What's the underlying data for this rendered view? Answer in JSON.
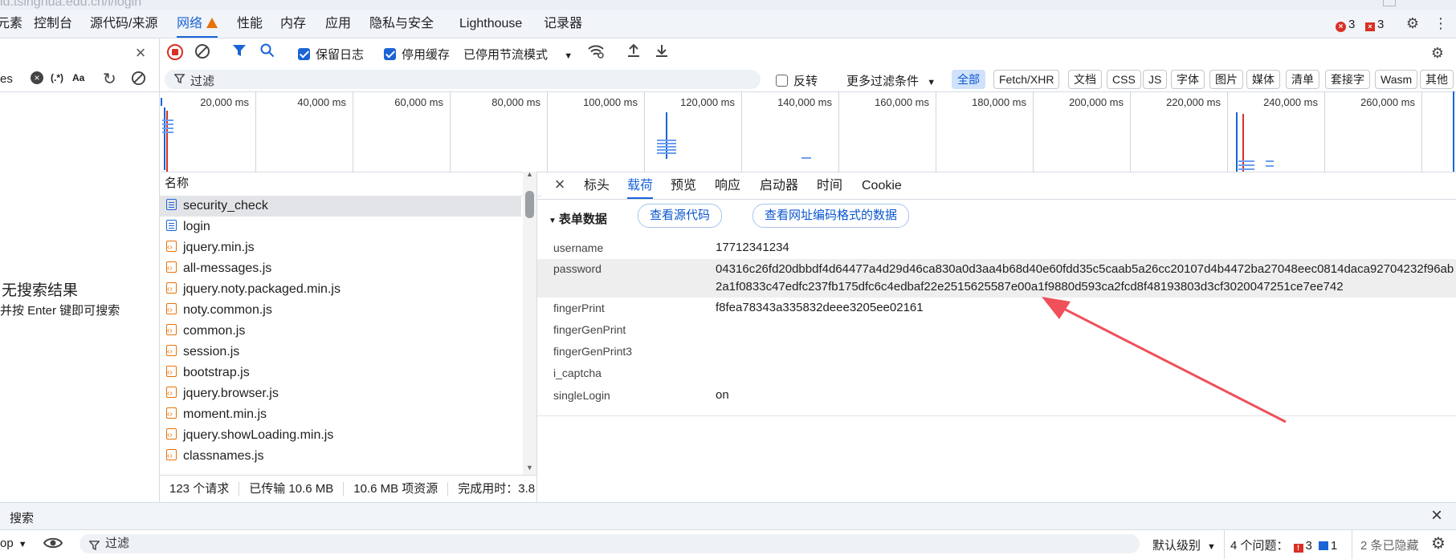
{
  "url": "id.tsinghua.edu.cn/i/login",
  "main_tabs": [
    {
      "label": "元素"
    },
    {
      "label": "控制台"
    },
    {
      "label": "源代码/来源"
    },
    {
      "label": "网络"
    },
    {
      "label": "性能"
    },
    {
      "label": "内存"
    },
    {
      "label": "应用"
    },
    {
      "label": "隐私与安全"
    },
    {
      "label": "Lighthouse"
    },
    {
      "label": "记录器"
    }
  ],
  "issues": {
    "errors": "3",
    "warnings": "3"
  },
  "toolbar": {
    "preserve_log": "保留日志",
    "disable_cache": "停用缓存",
    "throttle": "已停用节流模式"
  },
  "left": {
    "search_prefix": "es",
    "regex": "(.*)",
    "case": "Aa",
    "no_results": "无搜索结果",
    "hint": "并按 Enter 键即可搜索"
  },
  "filter": {
    "placeholder": "过滤",
    "invert": "反转",
    "more": "更多过滤条件",
    "types": [
      "全部",
      "Fetch/XHR",
      "文档",
      "CSS",
      "JS",
      "字体",
      "图片",
      "媒体",
      "清单",
      "套接字",
      "Wasm",
      "其他"
    ]
  },
  "timeline_ticks": [
    "20,000 ms",
    "40,000 ms",
    "60,000 ms",
    "80,000 ms",
    "100,000 ms",
    "120,000 ms",
    "140,000 ms",
    "160,000 ms",
    "180,000 ms",
    "200,000 ms",
    "220,000 ms",
    "240,000 ms",
    "260,000 ms"
  ],
  "list": {
    "header": "名称",
    "rows": [
      {
        "name": "security_check",
        "type": "doc"
      },
      {
        "name": "login",
        "type": "doc"
      },
      {
        "name": "jquery.min.js",
        "type": "js"
      },
      {
        "name": "all-messages.js",
        "type": "js"
      },
      {
        "name": "jquery.noty.packaged.min.js",
        "type": "js"
      },
      {
        "name": "noty.common.js",
        "type": "js"
      },
      {
        "name": "common.js",
        "type": "js"
      },
      {
        "name": "session.js",
        "type": "js"
      },
      {
        "name": "bootstrap.js",
        "type": "js"
      },
      {
        "name": "jquery.browser.js",
        "type": "js"
      },
      {
        "name": "moment.min.js",
        "type": "js"
      },
      {
        "name": "jquery.showLoading.min.js",
        "type": "js"
      },
      {
        "name": "classnames.js",
        "type": "js"
      }
    ],
    "status": {
      "requests": "123 个请求",
      "transferred": "已传输 10.6 MB",
      "resources": "10.6 MB 项资源",
      "finish": "完成用时：3.8"
    }
  },
  "detail": {
    "tabs": [
      "标头",
      "载荷",
      "预览",
      "响应",
      "启动器",
      "时间",
      "Cookie"
    ],
    "section": "表单数据",
    "view_source": "查看源代码",
    "view_url_encoded": "查看网址编码格式的数据",
    "fields": [
      {
        "key": "username",
        "value": "17712341234"
      },
      {
        "key": "password",
        "value": "04316c26fd20dbbdf4d64477a4d29d46ca830a0d3aa4b68d40e60fdd35c5caab5a26cc20107d4b4472ba27048eec0814daca92704232f96ab2a1f0833c47edfc237fb175dfc6c4edbaf22e2515625587e00a1f9880d593ca2fcd8f48193803d3cf3020047251ce7ee742"
      },
      {
        "key": "fingerPrint",
        "value": "f8fea78343a335832deee3205ee02161"
      },
      {
        "key": "fingerGenPrint",
        "value": ""
      },
      {
        "key": "fingerGenPrint3",
        "value": ""
      },
      {
        "key": "i_captcha",
        "value": ""
      },
      {
        "key": "singleLogin",
        "value": "on"
      }
    ]
  },
  "drawer": {
    "title": "搜索"
  },
  "console": {
    "context": "op",
    "filter_placeholder": "过滤",
    "level": "默认级别",
    "issues_label": "4 个问题：",
    "issue_errors": "3",
    "issue_info": "1",
    "hidden": "2 条已隐藏"
  },
  "colors": {
    "accent": "#1a64d6",
    "error": "#d93025",
    "arrow": "#f0505a"
  }
}
